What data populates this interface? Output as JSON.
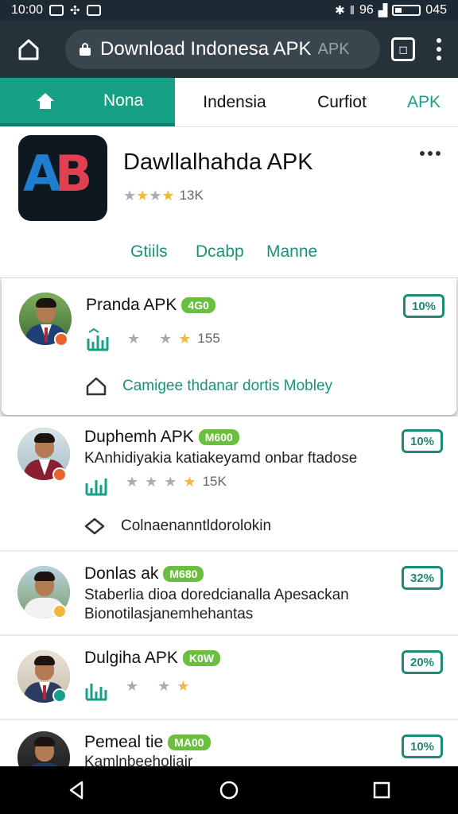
{
  "status_bar": {
    "time": "10:00",
    "network": "96",
    "battery_text": "045"
  },
  "browser": {
    "url": "Download Indonesa APK",
    "url_faint": "APK"
  },
  "tabs": [
    {
      "label": "Nona"
    },
    {
      "label": "Indensia"
    },
    {
      "label": "Curfiot"
    },
    {
      "label": "APK"
    }
  ],
  "app": {
    "title": "Dawllalhahda APK",
    "rating_count": "13K",
    "stars": [
      0,
      1,
      0,
      1
    ],
    "actions": [
      "Gtiils",
      "Dcabp",
      "Manne"
    ]
  },
  "items": [
    {
      "name": "Pranda APK",
      "tag": "4G0",
      "pct": "10%",
      "rating": "155",
      "link": "Camigee thdanar dortis Mobley"
    },
    {
      "name": "Duphemh APK",
      "tag": "M600",
      "pct": "10%",
      "desc": "KAnhidiyakia katiakeyamd onbar ftadose",
      "rating": "15K",
      "link": "Colnaenanntldorolokin"
    },
    {
      "name": "Donlas ak",
      "tag": "M680",
      "pct": "32%",
      "desc": "Staberlia dioa doredcianalla Apesackan",
      "desc2": "Bionotilasjanemhehantas"
    },
    {
      "name": "Dulgiha APK",
      "tag": "K0W",
      "pct": "20%"
    },
    {
      "name": "Pemeal tie",
      "tag": "MA00",
      "pct": "10%",
      "desc": "Kamlnbeeholiair"
    }
  ],
  "colors": {
    "accent": "#16a085",
    "tag": "#6abf3e",
    "star": "#f0b93b"
  }
}
